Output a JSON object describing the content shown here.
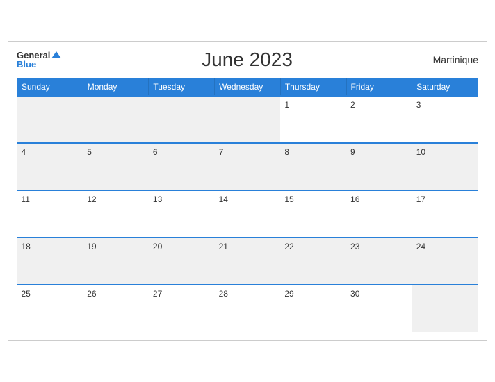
{
  "header": {
    "title": "June 2023",
    "region": "Martinique",
    "logo": {
      "general": "General",
      "blue": "Blue"
    }
  },
  "days_of_week": [
    "Sunday",
    "Monday",
    "Tuesday",
    "Wednesday",
    "Thursday",
    "Friday",
    "Saturday"
  ],
  "weeks": [
    [
      {
        "date": "",
        "empty": true
      },
      {
        "date": "",
        "empty": true
      },
      {
        "date": "",
        "empty": true
      },
      {
        "date": "",
        "empty": true
      },
      {
        "date": "1"
      },
      {
        "date": "2"
      },
      {
        "date": "3"
      }
    ],
    [
      {
        "date": "4"
      },
      {
        "date": "5"
      },
      {
        "date": "6"
      },
      {
        "date": "7"
      },
      {
        "date": "8"
      },
      {
        "date": "9"
      },
      {
        "date": "10"
      }
    ],
    [
      {
        "date": "11"
      },
      {
        "date": "12"
      },
      {
        "date": "13"
      },
      {
        "date": "14"
      },
      {
        "date": "15"
      },
      {
        "date": "16"
      },
      {
        "date": "17"
      }
    ],
    [
      {
        "date": "18"
      },
      {
        "date": "19"
      },
      {
        "date": "20"
      },
      {
        "date": "21"
      },
      {
        "date": "22"
      },
      {
        "date": "23"
      },
      {
        "date": "24"
      }
    ],
    [
      {
        "date": "25"
      },
      {
        "date": "26"
      },
      {
        "date": "27"
      },
      {
        "date": "28"
      },
      {
        "date": "29"
      },
      {
        "date": "30"
      },
      {
        "date": "",
        "empty": true
      }
    ]
  ]
}
